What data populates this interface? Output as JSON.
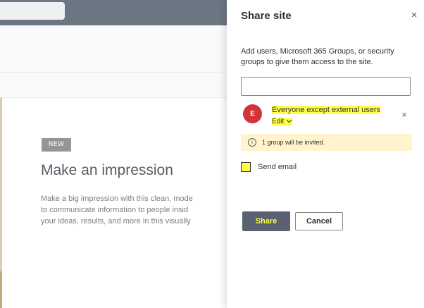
{
  "background": {
    "badge": "NEW",
    "title": "Make an impression",
    "text_lines": [
      "Make a big impression with this clean, mode",
      "to communicate information to people insid",
      "your ideas, results, and more in this visually"
    ]
  },
  "panel": {
    "title": "Share site",
    "close_icon": "×",
    "description": "Add users, Microsoft 365 Groups, or security groups to give them access to the site.",
    "search": {
      "value": "",
      "placeholder": ""
    },
    "entity": {
      "initial": "E",
      "name": "Everyone except external users",
      "permission_label": "Edit",
      "permission_icon": "chevron-down-icon",
      "remove_icon": "×",
      "avatar_color": "#d13438"
    },
    "info": {
      "icon": "i",
      "text": "1 group will be invited."
    },
    "send_email_label": "Send email",
    "share_label": "Share",
    "cancel_label": "Cancel"
  },
  "colors": {
    "highlight": "#ffff4a",
    "info_bg": "#fff4ce",
    "primary_button": "#5a6170"
  }
}
